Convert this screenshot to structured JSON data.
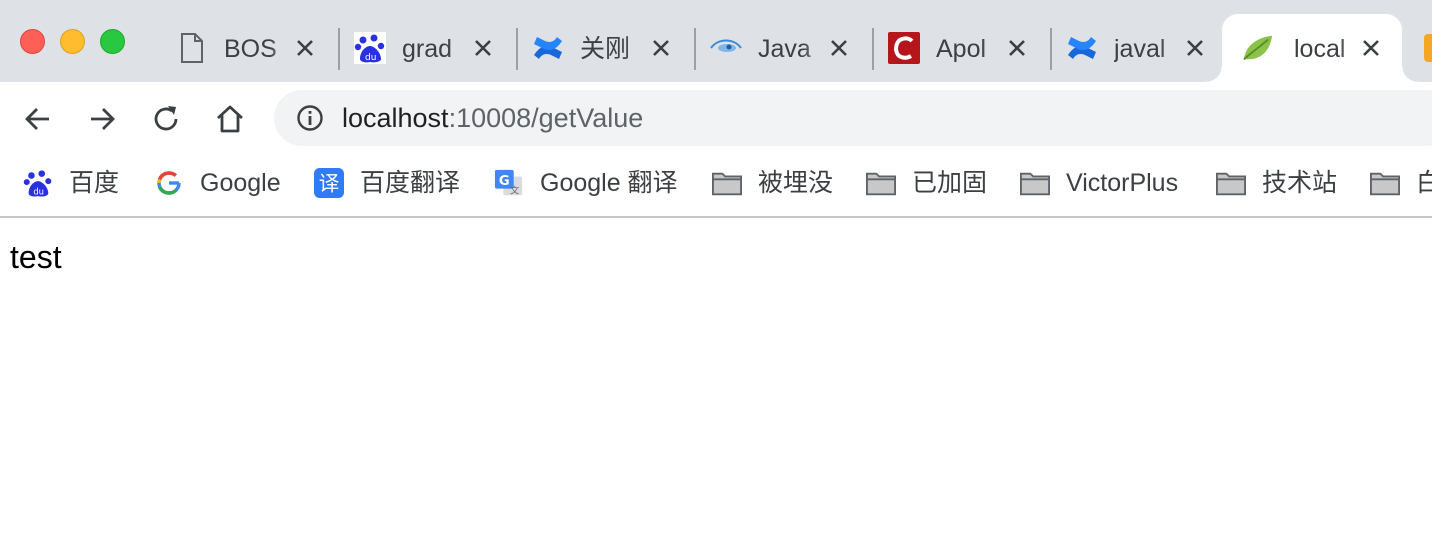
{
  "window": {
    "controls": [
      "close",
      "minimize",
      "maximize"
    ]
  },
  "tabs": [
    {
      "title": "BOS",
      "icon": "document-icon",
      "active": false
    },
    {
      "title": "grad",
      "icon": "baidu-icon",
      "active": false
    },
    {
      "title": "关刚",
      "icon": "confluence-icon",
      "active": false
    },
    {
      "title": "Java",
      "icon": "eye-icon",
      "active": false
    },
    {
      "title": "Apol",
      "icon": "c-logo-icon",
      "active": false
    },
    {
      "title": "javal",
      "icon": "confluence-icon",
      "active": false
    },
    {
      "title": "local",
      "icon": "spring-leaf-icon",
      "active": true
    }
  ],
  "toolbar": {
    "url_host": "localhost",
    "url_rest": ":10008/getValue"
  },
  "bookmarks": [
    {
      "label": "百度",
      "icon": "baidu-icon"
    },
    {
      "label": "Google",
      "icon": "google-icon"
    },
    {
      "label": "百度翻译",
      "icon": "translate-icon"
    },
    {
      "label": "Google 翻译",
      "icon": "google-translate-icon"
    },
    {
      "label": "被埋没",
      "icon": "folder-icon"
    },
    {
      "label": "已加固",
      "icon": "folder-icon"
    },
    {
      "label": "VictorPlus",
      "icon": "folder-icon"
    },
    {
      "label": "技术站",
      "icon": "folder-icon"
    },
    {
      "label": "白",
      "icon": "folder-icon"
    }
  ],
  "page": {
    "body_text": "test"
  },
  "colors": {
    "tabstrip_bg": "#dee1e6",
    "omnibox_bg": "#f1f3f4",
    "text_dark": "#202124",
    "text_muted": "#5f6368"
  }
}
